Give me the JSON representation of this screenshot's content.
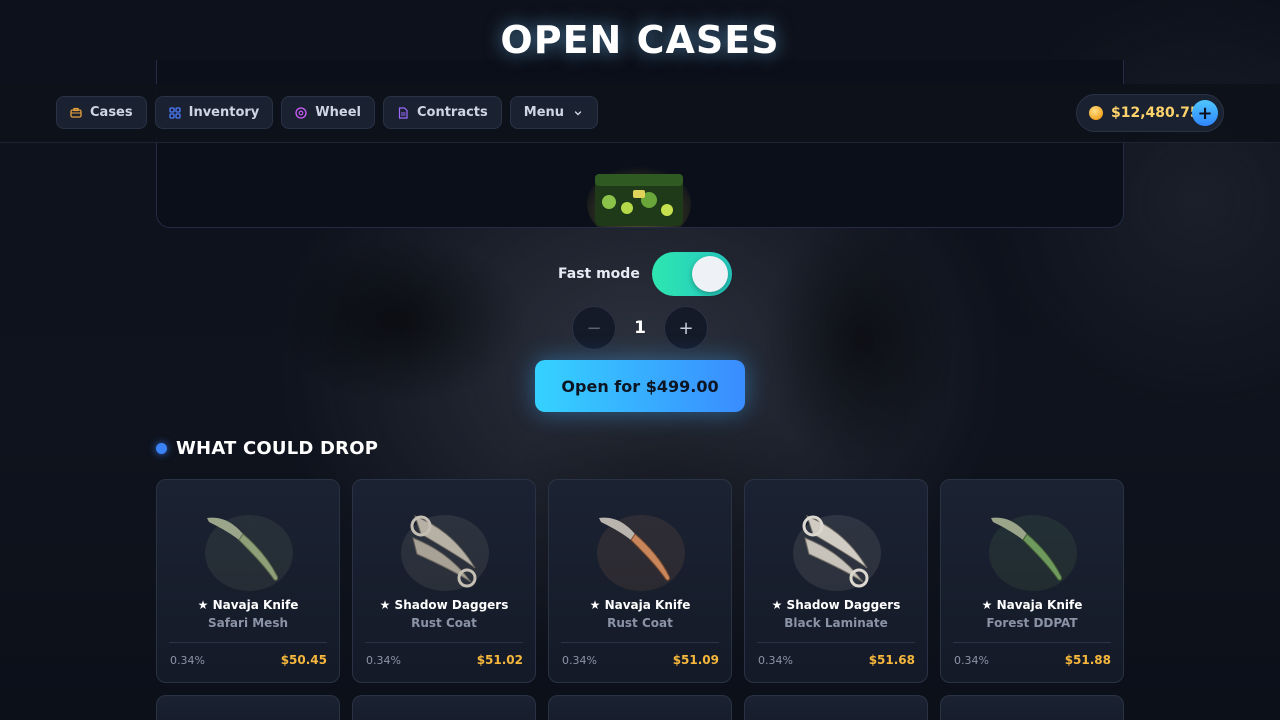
{
  "page_title": "OPEN CASES",
  "nav": {
    "items": [
      {
        "label": "Cases",
        "icon": "case-icon",
        "color": "#e8a33d"
      },
      {
        "label": "Inventory",
        "icon": "grid-icon",
        "color": "#4d7cff"
      },
      {
        "label": "Wheel",
        "icon": "wheel-icon",
        "color": "#d05cff"
      },
      {
        "label": "Contracts",
        "icon": "document-icon",
        "color": "#9b6bff"
      },
      {
        "label": "Menu",
        "icon": "chevron-down-icon",
        "color": "#cfd5e3"
      }
    ],
    "balance": "$12,480.75",
    "add_funds_icon": "plus-icon"
  },
  "controls": {
    "fast_mode_label": "Fast mode",
    "fast_mode_on": true,
    "quantity": "1",
    "minus_symbol": "−",
    "plus_symbol": "+",
    "open_button_label": "Open for $499.00"
  },
  "drops": {
    "heading": "WHAT COULD DROP",
    "items": [
      {
        "name": "★ Navaja Knife",
        "skin": "Safari Mesh",
        "chance": "0.34%",
        "price": "$50.45",
        "icon": "navaja-knife-icon",
        "tint": "#8ea07a"
      },
      {
        "name": "★ Shadow Daggers",
        "skin": "Rust Coat",
        "chance": "0.34%",
        "price": "$51.02",
        "icon": "shadow-daggers-icon",
        "tint": "#b7b1a5"
      },
      {
        "name": "★ Navaja Knife",
        "skin": "Rust Coat",
        "chance": "0.34%",
        "price": "$51.09",
        "icon": "navaja-knife-icon",
        "tint": "#c9865a"
      },
      {
        "name": "★ Shadow Daggers",
        "skin": "Black Laminate",
        "chance": "0.34%",
        "price": "$51.68",
        "icon": "shadow-daggers-icon",
        "tint": "#c8c3ba"
      },
      {
        "name": "★ Navaja Knife",
        "skin": "Forest DDPAT",
        "chance": "0.34%",
        "price": "$51.88",
        "icon": "navaja-knife-icon",
        "tint": "#6f9a5e"
      }
    ]
  },
  "colors": {
    "accent": "#3b82f6",
    "price": "#f6b73c",
    "toggle_on": "#2ee6b0",
    "open_button": "#35d2ff"
  }
}
